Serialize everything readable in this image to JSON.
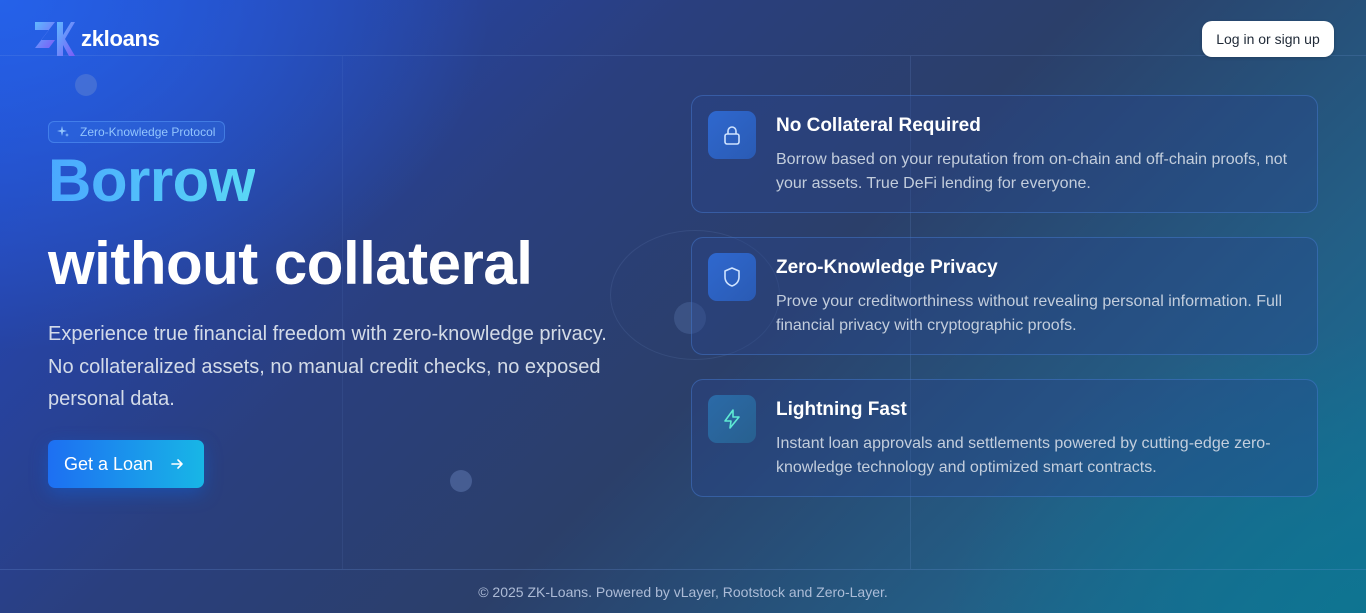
{
  "header": {
    "brand_name": "zkloans",
    "login_label": "Log in or sign up"
  },
  "hero": {
    "badge": "Zero-Knowledge Protocol",
    "title_line1": "Borrow",
    "title_line2": "without collateral",
    "description": "Experience true financial freedom with zero-knowledge privacy. No collateralized assets, no manual credit checks, no exposed personal data.",
    "cta_label": "Get a Loan"
  },
  "features": [
    {
      "icon": "lock-icon",
      "title": "No Collateral Required",
      "body": "Borrow based on your reputation from on-chain and off-chain proofs, not your assets. True DeFi lending for everyone."
    },
    {
      "icon": "shield-icon",
      "title": "Zero-Knowledge Privacy",
      "body": "Prove your creditworthiness without revealing personal information. Full financial privacy with cryptographic proofs."
    },
    {
      "icon": "lightning-icon",
      "title": "Lightning Fast",
      "body": "Instant loan approvals and settlements powered by cutting-edge zero-knowledge technology and optimized smart contracts."
    }
  ],
  "footer": {
    "text": "© 2025 ZK-Loans. Powered by vLayer, Rootstock and Zero-Layer."
  },
  "colors": {
    "accent": "#4cc2ff",
    "cta_start": "#1d6ff2",
    "cta_end": "#18b6e6"
  }
}
